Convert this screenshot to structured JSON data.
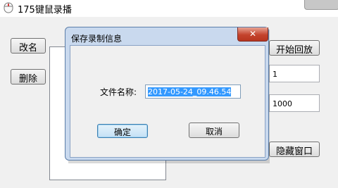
{
  "window": {
    "title": "175键鼠录播",
    "icon": "mouse-icon"
  },
  "main": {
    "rename_label": "改名",
    "delete_label": "删除",
    "start_playback_label": "开始回放",
    "field1_value": "1",
    "field2_value": "1000",
    "hide_window_label": "隐藏窗口"
  },
  "dialog": {
    "title": "保存录制信息",
    "close_glyph": "✕",
    "filename_label": "文件名称:",
    "filename_value": "2017-05-24_09.46.54",
    "ok_label": "确定",
    "cancel_label": "取消"
  }
}
